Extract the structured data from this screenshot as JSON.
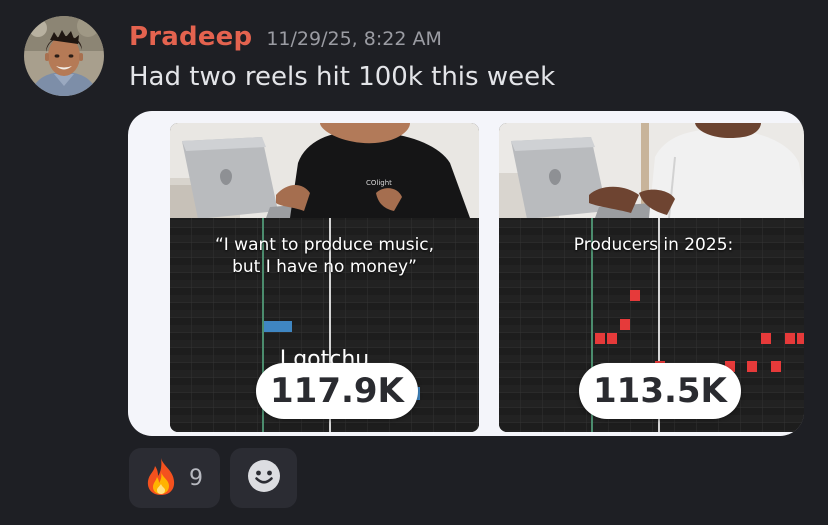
{
  "message": {
    "author": "Pradeep",
    "timestamp": "11/29/25, 8:22 AM",
    "text": "Had two reels hit 100k this week",
    "author_color": "#e4634f"
  },
  "reels": [
    {
      "caption": "“I want to produce music, but I have no money”",
      "sub_caption": "I gotchu",
      "views": "117.9K",
      "shirt_logo": "COlight"
    },
    {
      "caption": "Producers in 2025:",
      "views": "113.5K"
    }
  ],
  "reactions": [
    {
      "emoji": "fire-icon",
      "glyph": "🔥",
      "count": "9"
    }
  ],
  "add_reaction_icon": "smile-icon"
}
